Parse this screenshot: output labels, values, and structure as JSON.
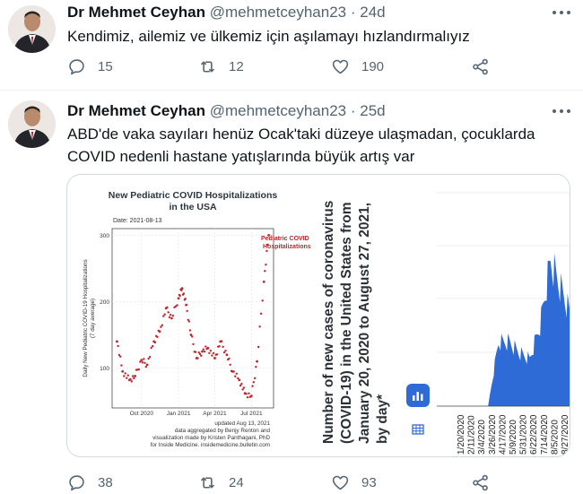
{
  "tweets": [
    {
      "name": "Dr Mehmet Ceyhan",
      "handle": "@mehmetceyhan23",
      "time": "24d",
      "text": "Kendimiz, ailemiz ve ülkemiz için aşılamayı hızlandırmalıyız",
      "replies": "15",
      "retweets": "12",
      "likes": "190"
    },
    {
      "name": "Dr Mehmet Ceyhan",
      "handle": "@mehmetceyhan23",
      "time": "25d",
      "text_line1": "ABD'de vaka sayıları henüz Ocak'taki düzeye ulaşmadan, çocuklarda",
      "text_line2": "COVID nedenli hastane yatışlarında büyük artış var",
      "replies": "38",
      "retweets": "24",
      "likes": "93"
    }
  ],
  "media": {
    "chart_left": {
      "title_line1": "New Pediatric COVID Hospitalizations",
      "title_line2": "in the USA",
      "date_label": "Date: 2021-08-13",
      "ylabel_line1": "Daily New Pediatric COVID-19 Hospitalizations",
      "ylabel_line2": "(7 day average)",
      "legend_line1": "Pediatric COVID",
      "legend_line2": "Hospitalizations",
      "ytick_labels": [
        "100",
        "200",
        "300"
      ],
      "xtick_labels": [
        "Oct 2020",
        "Jan 2021",
        "Apr 2021",
        "Jul 2021"
      ],
      "footer": [
        "updated Aug 13, 2021",
        "data aggregated by Benjy Renton and",
        "visualization made by Kristen Panthagani, PhD",
        "for Inside Medicine. insidemedicine.bulletin.com"
      ],
      "accent": "#c0262d"
    },
    "vertical_title": "Number of new cases of coronavirus (COVID-19) in the United States from January 20, 2020 to August 27, 2021, by day*",
    "chart_right": {
      "xtick_labels": [
        "1/20/2020",
        "2/11/2020",
        "3/4/2020",
        "3/26/2020",
        "4/17/2020",
        "5/9/2020",
        "5/31/2020",
        "6/22/2020",
        "7/14/2020",
        "8/5/2020",
        "8/27/2020"
      ],
      "bar_color": "#2f6bd6"
    },
    "buttons": {
      "chart_icon": "bar-chart-icon",
      "table_icon": "table-icon"
    }
  },
  "chart_data": [
    {
      "type": "scatter",
      "title": "New Pediatric COVID Hospitalizations in the USA",
      "ylabel": "Daily New Pediatric COVID-19 Hospitalizations (7 day average)",
      "x": [
        "2020-08-01",
        "2020-08-15",
        "2020-09-01",
        "2020-09-15",
        "2020-10-01",
        "2020-10-15",
        "2020-11-01",
        "2020-11-15",
        "2020-12-01",
        "2020-12-15",
        "2021-01-01",
        "2021-01-10",
        "2021-01-20",
        "2021-02-01",
        "2021-02-15",
        "2021-03-01",
        "2021-03-15",
        "2021-04-01",
        "2021-04-15",
        "2021-05-01",
        "2021-05-15",
        "2021-06-01",
        "2021-06-15",
        "2021-07-01",
        "2021-07-15",
        "2021-08-01",
        "2021-08-13"
      ],
      "values": [
        140,
        95,
        82,
        88,
        112,
        105,
        140,
        155,
        190,
        175,
        205,
        220,
        195,
        150,
        115,
        125,
        130,
        115,
        140,
        120,
        95,
        82,
        62,
        58,
        110,
        230,
        300
      ],
      "ylim": [
        40,
        310
      ],
      "series_name": "Pediatric COVID Hospitalizations"
    },
    {
      "type": "bar",
      "title": "Number of new cases of coronavirus (COVID-19) in the United States from January 20, 2020 to August 27, 2021, by day*",
      "categories": [
        "1/20/2020",
        "2/11/2020",
        "3/4/2020",
        "3/26/2020",
        "4/17/2020",
        "5/9/2020",
        "5/31/2020",
        "6/22/2020",
        "7/14/2020",
        "8/5/2020",
        "8/27/2020"
      ],
      "values": [
        0,
        0,
        50,
        30000,
        30000,
        25000,
        22000,
        38000,
        68000,
        55000,
        42000
      ]
    }
  ]
}
